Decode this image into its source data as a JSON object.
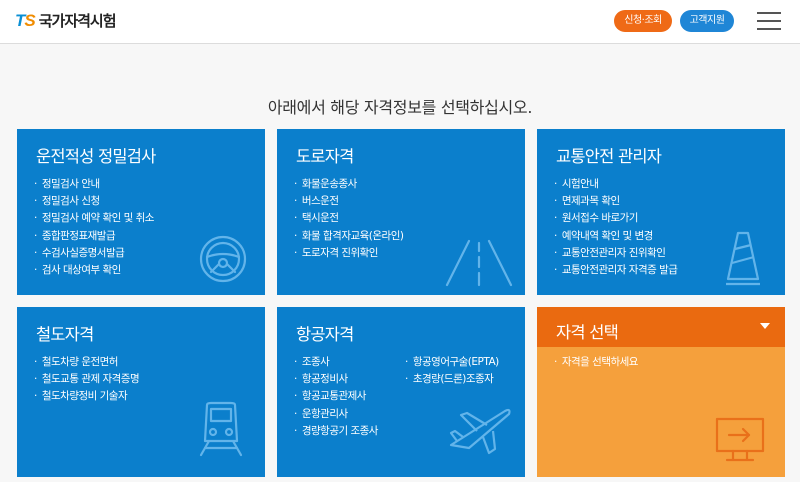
{
  "header": {
    "logo_mark_t": "T",
    "logo_mark_s": "S",
    "logo_text": "국가자격시험",
    "apply_button": "신청·조회",
    "support_button": "고객지원",
    "menu_icon": "hamburger-icon"
  },
  "main": {
    "subtitle": "아래에서 해당 자격정보를 선택하십시오."
  },
  "cards": {
    "driving": {
      "title": "운전적성 정밀검사",
      "items": [
        "정밀검사 안내",
        "정밀검사 신청",
        "정밀검사 예약 확인 및 취소",
        "종합판정표재발급",
        "수검사실증명서발급",
        "검사 대상여부 확인"
      ],
      "icon": "steering-wheel-icon"
    },
    "road": {
      "title": "도로자격",
      "items": [
        "화물운송종사",
        "버스운전",
        "택시운전",
        "화물 합격자교육(온라인)",
        "도로자격 진위확인"
      ],
      "icon": "road-icon"
    },
    "safety": {
      "title": "교통안전 관리자",
      "items": [
        "시험안내",
        "면제과목 확인",
        "원서접수 바로가기",
        "예약내역 확인 및 변경",
        "교통안전관리자 진위확인",
        "교통안전관리자 자격증 발급"
      ],
      "icon": "traffic-cone-icon"
    },
    "rail": {
      "title": "철도자격",
      "items": [
        "철도차량 운전면허",
        "철도교통 관제 자격증명",
        "철도차량정비 기술자"
      ],
      "icon": "train-icon"
    },
    "aviation": {
      "title": "항공자격",
      "items_left": [
        "조종사",
        "항공정비사",
        "항공교통관제사",
        "운항관리사",
        "경량항공기 조종사"
      ],
      "items_right": [
        "항공영어구술(EPTA)",
        "초경량(드론)조종자"
      ],
      "icon": "airplane-icon"
    },
    "select": {
      "title": "자격 선택",
      "hint": "자격을 선택하세요",
      "icon": "monitor-arrow-icon"
    }
  },
  "colors": {
    "card_blue": "#0b7fcc",
    "select_header": "#ea6a10",
    "select_body": "#f5a03c",
    "apply_button": "#ef6a16",
    "support_button": "#1f86d6"
  }
}
